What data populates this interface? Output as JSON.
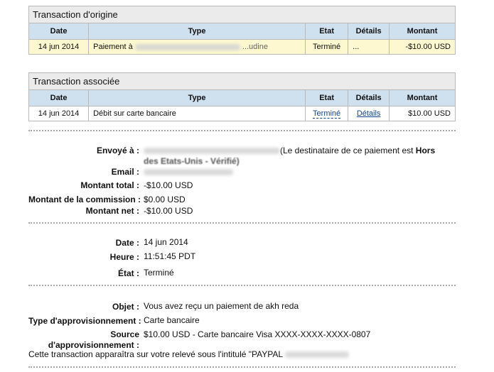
{
  "origin": {
    "title": "Transaction d'origine",
    "headers": {
      "date": "Date",
      "type": "Type",
      "etat": "Etat",
      "details": "Détails",
      "montant": "Montant"
    },
    "row": {
      "date": "14 jun 2014",
      "type_prefix": "Paiement à",
      "type_suffix": "...udine",
      "etat": "Terminé",
      "details": "...",
      "montant": "-$10.00 USD"
    }
  },
  "related": {
    "title": "Transaction associée",
    "headers": {
      "date": "Date",
      "type": "Type",
      "etat": "Etat",
      "details": "Détails",
      "montant": "Montant"
    },
    "row": {
      "date": "14 jun 2014",
      "type": "Débit sur carte bancaire",
      "etat": "Terminé",
      "details": "Détails",
      "montant": "$10.00 USD"
    }
  },
  "summary": {
    "envoye_label": "Envoyé à :",
    "envoye_note_prefix": "(Le destinataire de ce paiement est",
    "envoye_note_bold1": "Hors",
    "envoye_note_bold2": "des Etats-Unis - Vérifié)",
    "email_label": "Email :",
    "total_label": "Montant total :",
    "total_value": "-$10.00 USD",
    "commission_label": "Montant de la commission :",
    "commission_value": "$0.00 USD",
    "net_label": "Montant net :",
    "net_value": "-$10.00 USD"
  },
  "status": {
    "date_label": "Date :",
    "date_value": "14 jun 2014",
    "heure_label": "Heure :",
    "heure_value": "11:51:45 PDT",
    "etat_label": "État :",
    "etat_value": "Terminé"
  },
  "details": {
    "objet_label": "Objet :",
    "objet_value": "Vous avez reçu un paiement de akh reda",
    "appro_label": "Type d'approvisionnement :",
    "appro_value": "Carte bancaire",
    "source_label_1": "Source",
    "source_label_2": "d'approvisionnement :",
    "source_value": "$10.00 USD - Carte bancaire Visa XXXX-XXXX-XXXX-0807",
    "releve_text": "Cette transaction apparaîtra sur votre relevé sous l'intitulé \"PAYPAL"
  }
}
